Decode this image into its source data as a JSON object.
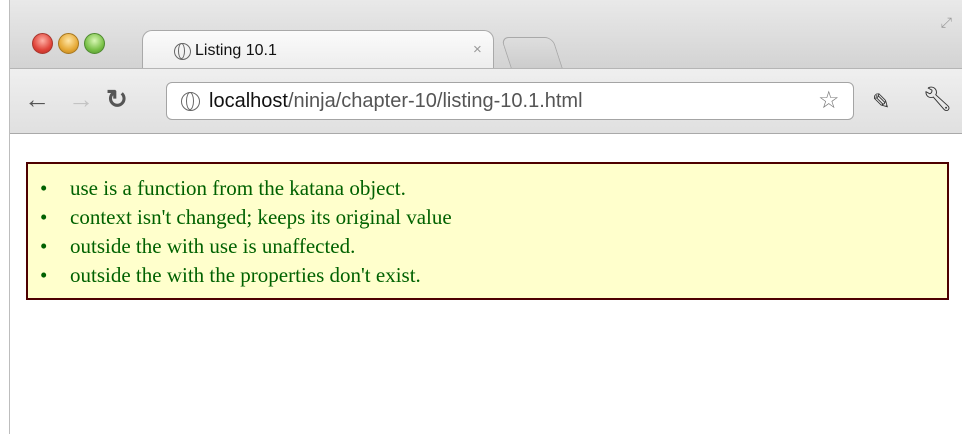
{
  "tab": {
    "title": "Listing 10.1",
    "close_glyph": "×"
  },
  "address": {
    "host": "localhost",
    "path": "/ninja/chapter-10/listing-10.1.html"
  },
  "results": {
    "items": [
      "use is a function from the katana object.",
      "context isn't changed; keeps its original value",
      "outside the with use is unaffected.",
      "outside the with the properties don't exist."
    ],
    "text_color": "#006100",
    "background": "#ffffcc",
    "border_color": "#4d0000"
  },
  "icons": {
    "back": "arrow-left-icon",
    "forward": "arrow-right-icon",
    "reload": "reload-icon",
    "site": "globe-icon",
    "bookmark": "star-icon",
    "extension": "extension-icon",
    "menu": "wrench-icon"
  }
}
